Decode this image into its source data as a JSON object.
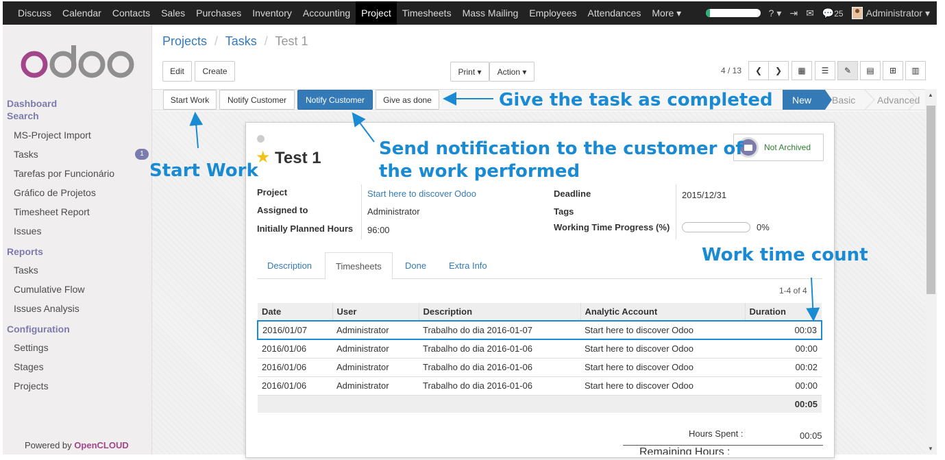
{
  "topbar": {
    "menu": [
      "Discuss",
      "Calendar",
      "Contacts",
      "Sales",
      "Purchases",
      "Inventory",
      "Accounting",
      "Project",
      "Timesheets",
      "Mass Mailing",
      "Employees",
      "Attendances",
      "More ▾"
    ],
    "active": "Project",
    "progress_percent": 8,
    "help": "? ▾",
    "message_count": "25",
    "user": "Administrator ▾"
  },
  "sidebar": {
    "logo_text": "odoo",
    "section_dashboard": "Dashboard",
    "section_search": "Search",
    "search_items": [
      "MS-Project Import",
      "Tasks",
      "Tarefas por Funcionário",
      "Gráfico de Projetos",
      "Timesheet Report",
      "Issues"
    ],
    "tasks_badge": "1",
    "section_reports": "Reports",
    "report_items": [
      "Tasks",
      "Cumulative Flow",
      "Issues Analysis"
    ],
    "section_config": "Configuration",
    "config_items": [
      "Settings",
      "Stages",
      "Projects"
    ],
    "powered_label": "Powered by",
    "powered_brand": "OpenCLOUD"
  },
  "breadcrumb": {
    "projects": "Projects",
    "tasks": "Tasks",
    "current": "Test 1",
    "sep": "/"
  },
  "buttons": {
    "edit": "Edit",
    "create": "Create",
    "print": "Print ▾",
    "action": "Action ▾",
    "start_work": "Start Work",
    "notify_customer": "Notify Customer",
    "notify_customer_2": "Notify Customer",
    "give_done": "Give as done"
  },
  "pager": {
    "text": "4 / 13"
  },
  "stages": {
    "new": "New",
    "basic": "Basic",
    "advanced": "Advanced"
  },
  "task": {
    "title": "Test 1",
    "archived": "Not Archived",
    "labels": {
      "project": "Project",
      "assigned": "Assigned to",
      "planned": "Initially Planned Hours",
      "deadline": "Deadline",
      "tags": "Tags",
      "progress": "Working Time Progress (%)"
    },
    "project": "Start here to discover Odoo",
    "assigned": "Administrator",
    "planned": "96:00",
    "deadline": "2015/12/31",
    "progress_value": "0%"
  },
  "tabs": [
    "Description",
    "Timesheets",
    "Done",
    "Extra Info"
  ],
  "timesheets": {
    "pager": "1-4 of 4",
    "headers": [
      "Date",
      "User",
      "Description",
      "Analytic Account",
      "Duration"
    ],
    "rows": [
      [
        "2016/01/07",
        "Administrator",
        "Trabalho do dia 2016-01-07",
        "Start here to discover Odoo",
        "00:03"
      ],
      [
        "2016/01/06",
        "Administrator",
        "Trabalho do dia 2016-01-06",
        "Start here to discover Odoo",
        "00:00"
      ],
      [
        "2016/01/06",
        "Administrator",
        "Trabalho do dia 2016-01-06",
        "Start here to discover Odoo",
        "00:02"
      ],
      [
        "2016/01/06",
        "Administrator",
        "Trabalho do dia 2016-01-06",
        "Start here to discover Odoo",
        "00:00"
      ]
    ],
    "total": "00:05",
    "hours_spent_label": "Hours Spent :",
    "hours_spent": "00:05",
    "remaining_label": "Remaining Hours :"
  },
  "annotations": {
    "give_done": "Give the task as completed",
    "notify_1": "Send notification to the customer of",
    "notify_2": "the work performed",
    "start_work": "Start Work",
    "work_time": "Work time count"
  },
  "colors": {
    "accent": "#337ab7",
    "annotation": "#1a8bd3",
    "brand": "#7c7bad"
  }
}
